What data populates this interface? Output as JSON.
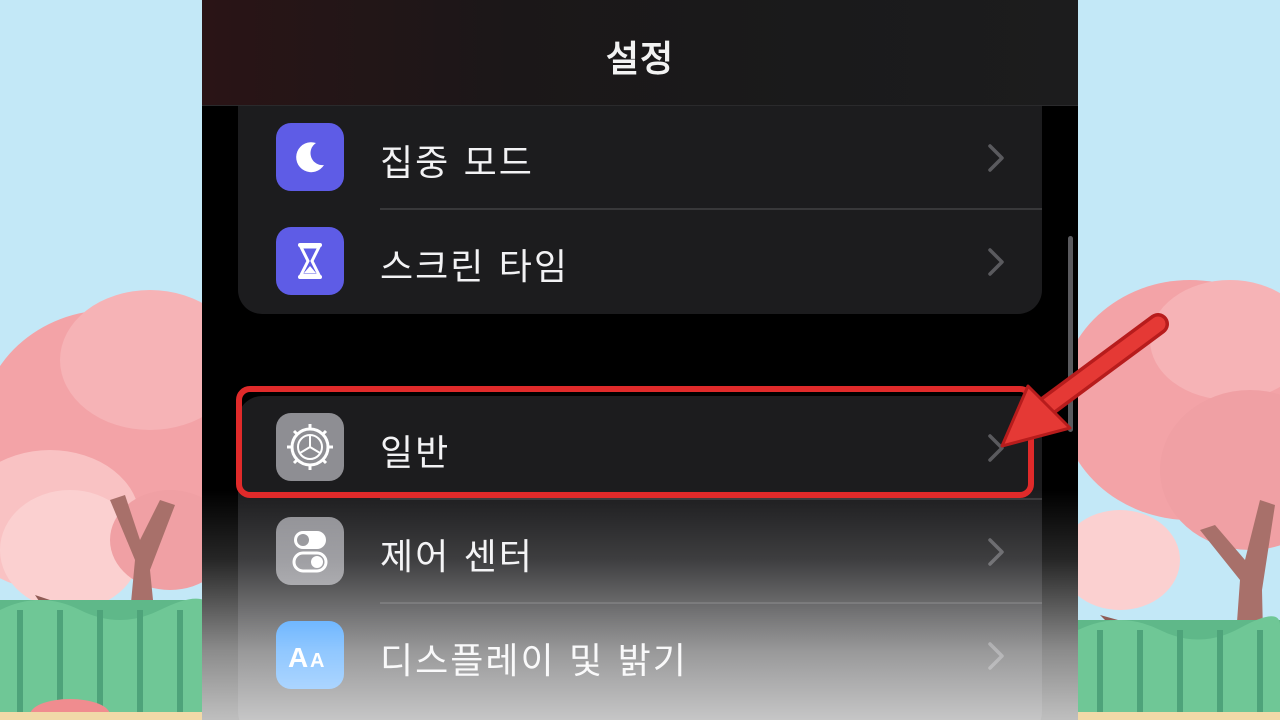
{
  "nav": {
    "title": "설정"
  },
  "group_a": [
    {
      "label": "집중 모드",
      "icon": "moon-icon",
      "color": "#5e5ce6"
    },
    {
      "label": "스크린 타임",
      "icon": "hourglass-icon",
      "color": "#5e5ce6"
    }
  ],
  "group_b": [
    {
      "label": "일반",
      "icon": "gear-icon",
      "color": "#8e8e93"
    },
    {
      "label": "제어 센터",
      "icon": "toggles-icon",
      "color": "#8e8e93"
    },
    {
      "label": "디스플레이 및 밝기",
      "icon": "display-aa-icon",
      "color": "#0a84ff"
    }
  ],
  "annotation": {
    "highlight_color": "#e02a2a"
  }
}
